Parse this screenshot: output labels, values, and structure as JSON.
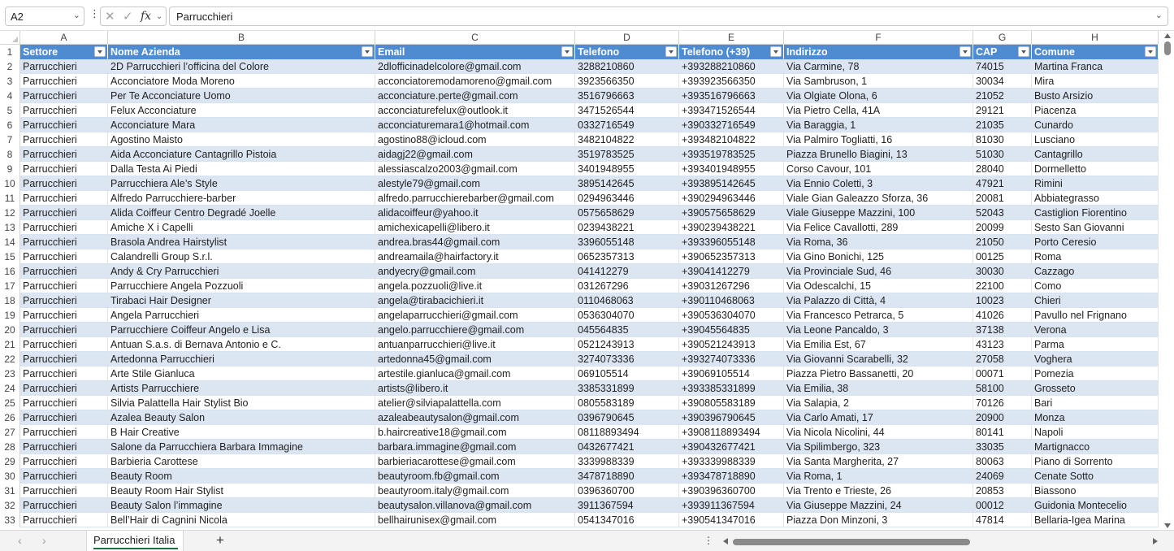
{
  "formula_bar": {
    "name_box": "A2",
    "formula": "Parrucchieri",
    "fx_label": "fx"
  },
  "grid": {
    "column_letters": [
      "A",
      "B",
      "C",
      "D",
      "E",
      "F",
      "G",
      "H"
    ],
    "header_row_number": "1",
    "headers": [
      "Settore",
      "Nome Azienda",
      "Email",
      "Telefono",
      "Telefono (+39)",
      "Indirizzo",
      "CAP",
      "Comune"
    ],
    "rows": [
      {
        "n": "2",
        "cells": [
          "Parrucchieri",
          "2D Parrucchieri l’officina del Colore",
          "2dlofficinadelcolore@gmail.com",
          "3288210860",
          "+393288210860",
          "Via Carmine, 78",
          "74015",
          "Martina Franca"
        ]
      },
      {
        "n": "3",
        "cells": [
          "Parrucchieri",
          "Acconciatore Moda Moreno",
          "acconciatoremodamoreno@gmail.com",
          "3923566350",
          "+393923566350",
          "Via Sambruson, 1",
          "30034",
          "Mira"
        ]
      },
      {
        "n": "4",
        "cells": [
          "Parrucchieri",
          "Per Te Acconciature Uomo",
          "acconciature.perte@gmail.com",
          "3516796663",
          "+393516796663",
          "Via Olgiate Olona, 6",
          "21052",
          "Busto Arsizio"
        ]
      },
      {
        "n": "5",
        "cells": [
          "Parrucchieri",
          "Felux Acconciature",
          "acconciaturefelux@outlook.it",
          "3471526544",
          "+393471526544",
          "Via Pietro Cella, 41A",
          "29121",
          "Piacenza"
        ]
      },
      {
        "n": "6",
        "cells": [
          "Parrucchieri",
          "Acconciature Mara",
          "acconciaturemara1@hotmail.com",
          "0332716549",
          "+390332716549",
          "Via Baraggia, 1",
          "21035",
          "Cunardo"
        ]
      },
      {
        "n": "7",
        "cells": [
          "Parrucchieri",
          "Agostino Maisto",
          "agostino88@icloud.com",
          "3482104822",
          "+393482104822",
          "Via Palmiro Togliatti, 16",
          "81030",
          "Lusciano"
        ]
      },
      {
        "n": "8",
        "cells": [
          "Parrucchieri",
          "Aida Acconciature Cantagrillo Pistoia",
          "aidagj22@gmail.com",
          "3519783525",
          "+393519783525",
          "Piazza Brunello Biagini, 13",
          "51030",
          "Cantagrillo"
        ]
      },
      {
        "n": "9",
        "cells": [
          "Parrucchieri",
          "Dalla Testa Ai Piedi",
          "alessiascalzo2003@gmail.com",
          "3401948955",
          "+393401948955",
          "Corso Cavour, 101",
          "28040",
          "Dormelletto"
        ]
      },
      {
        "n": "10",
        "cells": [
          "Parrucchieri",
          "Parrucchiera Ale’s Style",
          "alestyle79@gmail.com",
          "3895142645",
          "+393895142645",
          "Via Ennio Coletti, 3",
          "47921",
          "Rimini"
        ]
      },
      {
        "n": "11",
        "cells": [
          "Parrucchieri",
          "Alfredo Parrucchiere-barber",
          "alfredo.parrucchierebarber@gmail.com",
          "0294963446",
          "+390294963446",
          "Viale Gian Galeazzo Sforza, 36",
          "20081",
          "Abbiategrasso"
        ]
      },
      {
        "n": "12",
        "cells": [
          "Parrucchieri",
          "Alida Coiffeur Centro Degradé Joelle",
          "alidacoiffeur@yahoo.it",
          "0575658629",
          "+390575658629",
          "Viale Giuseppe Mazzini, 100",
          "52043",
          "Castiglion Fiorentino"
        ]
      },
      {
        "n": "13",
        "cells": [
          "Parrucchieri",
          "Amiche X i Capelli",
          "amichexicapelli@libero.it",
          "0239438221",
          "+390239438221",
          "Via Felice Cavallotti, 289",
          "20099",
          "Sesto San Giovanni"
        ]
      },
      {
        "n": "14",
        "cells": [
          "Parrucchieri",
          "Brasola Andrea Hairstylist",
          "andrea.bras44@gmail.com",
          "3396055148",
          "+393396055148",
          "Via Roma, 36",
          "21050",
          "Porto Ceresio"
        ]
      },
      {
        "n": "15",
        "cells": [
          "Parrucchieri",
          "Calandrelli Group S.r.l.",
          "andreamaila@hairfactory.it",
          "0652357313",
          "+390652357313",
          "Via Gino Bonichi, 125",
          "00125",
          "Roma"
        ]
      },
      {
        "n": "16",
        "cells": [
          "Parrucchieri",
          "Andy & Cry Parrucchieri",
          "andyecry@gmail.com",
          "041412279",
          "+39041412279",
          "Via Provinciale Sud, 46",
          "30030",
          "Cazzago"
        ]
      },
      {
        "n": "17",
        "cells": [
          "Parrucchieri",
          "Parrucchiere Angela Pozzuoli",
          "angela.pozzuoli@live.it",
          "031267296",
          "+39031267296",
          "Via Odescalchi, 15",
          "22100",
          "Como"
        ]
      },
      {
        "n": "18",
        "cells": [
          "Parrucchieri",
          "Tirabaci Hair Designer",
          "angela@tirabacichieri.it",
          "0110468063",
          "+390110468063",
          "Via Palazzo di Città, 4",
          "10023",
          "Chieri"
        ]
      },
      {
        "n": "19",
        "cells": [
          "Parrucchieri",
          "Angela Parrucchieri",
          "angelaparrucchieri@gmail.com",
          "0536304070",
          "+390536304070",
          "Via Francesco Petrarca, 5",
          "41026",
          "Pavullo nel Frignano"
        ]
      },
      {
        "n": "20",
        "cells": [
          "Parrucchieri",
          "Parrucchiere Coiffeur Angelo e Lisa",
          "angelo.parrucchiere@gmail.com",
          "045564835",
          "+39045564835",
          "Via Leone Pancaldo, 3",
          "37138",
          "Verona"
        ]
      },
      {
        "n": "21",
        "cells": [
          "Parrucchieri",
          "Antuan S.a.s. di Bernava Antonio e C.",
          "antuanparrucchieri@live.it",
          "0521243913",
          "+390521243913",
          "Via Emilia Est, 67",
          "43123",
          "Parma"
        ]
      },
      {
        "n": "22",
        "cells": [
          "Parrucchieri",
          "Artedonna Parrucchieri",
          "artedonna45@gmail.com",
          "3274073336",
          "+393274073336",
          "Via Giovanni Scarabelli, 32",
          "27058",
          "Voghera"
        ]
      },
      {
        "n": "23",
        "cells": [
          "Parrucchieri",
          "Arte Stile Gianluca",
          "artestile.gianluca@gmail.com",
          "069105514",
          "+39069105514",
          "Piazza Pietro Bassanetti, 20",
          "00071",
          "Pomezia"
        ]
      },
      {
        "n": "24",
        "cells": [
          "Parrucchieri",
          "Artists Parrucchiere",
          "artists@libero.it",
          "3385331899",
          "+393385331899",
          "Via Emilia, 38",
          "58100",
          "Grosseto"
        ]
      },
      {
        "n": "25",
        "cells": [
          "Parrucchieri",
          "Silvia Palattella Hair Stylist Bio",
          "atelier@silviapalattella.com",
          "0805583189",
          "+390805583189",
          "Via Salapia, 2",
          "70126",
          "Bari"
        ]
      },
      {
        "n": "26",
        "cells": [
          "Parrucchieri",
          "Azalea Beauty Salon",
          "azaleabeautysalon@gmail.com",
          "0396790645",
          "+390396790645",
          "Via Carlo Amati, 17",
          "20900",
          "Monza"
        ]
      },
      {
        "n": "27",
        "cells": [
          "Parrucchieri",
          "B Hair Creative",
          "b.haircreative18@gmail.com",
          "08118893494",
          "+3908118893494",
          "Via Nicola Nicolini, 44",
          "80141",
          "Napoli"
        ]
      },
      {
        "n": "28",
        "cells": [
          "Parrucchieri",
          "Salone da Parrucchiera Barbara Immagine",
          "barbara.immagine@gmail.com",
          "0432677421",
          "+390432677421",
          "Via Spilimbergo, 323",
          "33035",
          "Martignacco"
        ]
      },
      {
        "n": "29",
        "cells": [
          "Parrucchieri",
          "Barbieria Carottese",
          "barbieriacarottese@gmail.com",
          "3339988339",
          "+393339988339",
          "Via Santa Margherita, 27",
          "80063",
          "Piano di Sorrento"
        ]
      },
      {
        "n": "30",
        "cells": [
          "Parrucchieri",
          "Beauty Room",
          "beautyroom.fb@gmail.com",
          "3478718890",
          "+393478718890",
          "Via Roma, 1",
          "24069",
          "Cenate Sotto"
        ]
      },
      {
        "n": "31",
        "cells": [
          "Parrucchieri",
          "Beauty Room Hair Stylist",
          "beautyroom.italy@gmail.com",
          "0396360700",
          "+390396360700",
          "Via Trento e Trieste, 26",
          "20853",
          "Biassono"
        ]
      },
      {
        "n": "32",
        "cells": [
          "Parrucchieri",
          "Beauty Salon l’immagine",
          "beautysalon.villanova@gmail.com",
          "3911367594",
          "+393911367594",
          "Via Giuseppe Mazzini, 24",
          "00012",
          "Guidonia Montecelio"
        ]
      },
      {
        "n": "33",
        "cells": [
          "Parrucchieri",
          "Bell’Hair di Cagnini Nicola",
          "bellhairunisex@gmail.com",
          "0541347016",
          "+390541347016",
          "Piazza Don Minzoni, 3",
          "47814",
          "Bellaria-Igea Marina"
        ]
      }
    ]
  },
  "sheet_tabs": {
    "tabs": [
      "Parrucchieri Italia"
    ],
    "add_label": "+"
  },
  "colors": {
    "header_blue": "#4f8bd0",
    "band_blue": "#dce6f3",
    "active_green": "#1e6e42"
  }
}
